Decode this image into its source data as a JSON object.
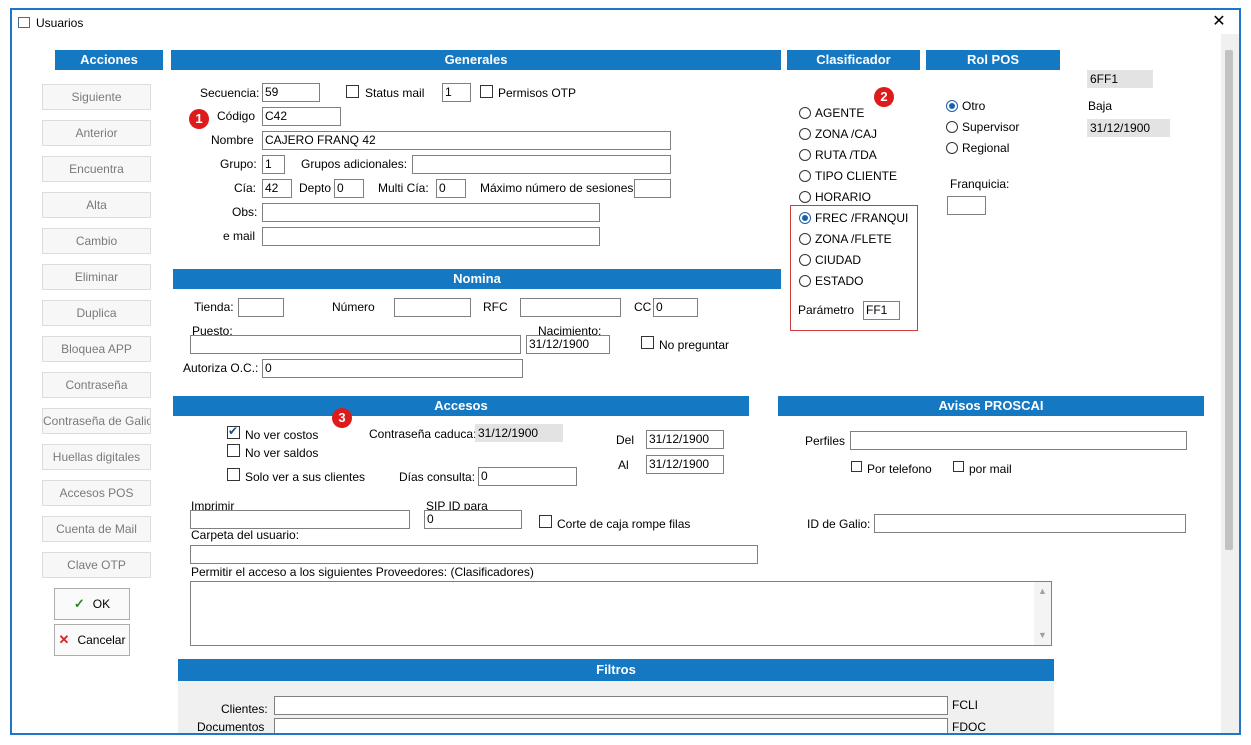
{
  "window": {
    "title": "Usuarios",
    "close": "✕"
  },
  "acciones": {
    "header": "Acciones",
    "items": [
      {
        "label": "Siguiente"
      },
      {
        "label": "Anterior"
      },
      {
        "label": "Encuentra"
      },
      {
        "label": "Alta"
      },
      {
        "label": "Cambio"
      },
      {
        "label": "Eliminar"
      },
      {
        "label": "Duplica"
      },
      {
        "label": "Bloquea APP"
      },
      {
        "label": "Contraseña"
      },
      {
        "label": "Contraseña de Galio"
      },
      {
        "label": "Huellas digitales"
      },
      {
        "label": "Accesos POS"
      },
      {
        "label": "Cuenta de Mail"
      },
      {
        "label": "Clave OTP"
      }
    ],
    "ok": "OK",
    "cancel": "Cancelar"
  },
  "generales": {
    "header": "Generales",
    "secuencia_label": "Secuencia:",
    "secuencia": "59",
    "status_mail_label": "Status mail",
    "status_mail_value": "1",
    "permisos_otp_label": "Permisos OTP",
    "codigo_label": "Código",
    "codigo": "C42",
    "nombre_label": "Nombre",
    "nombre": "CAJERO FRANQ 42",
    "grupo_label": "Grupo:",
    "grupo": "1",
    "grupos_adicionales_label": "Grupos adicionales:",
    "grupos_adicionales": "",
    "cia_label": "Cía:",
    "cia": "42",
    "depto_label": "Depto",
    "depto": "0",
    "multi_cia_label": "Multi Cía:",
    "multi_cia": "0",
    "max_sesiones_label": "Máximo número de sesiones:",
    "max_sesiones": "",
    "obs_label": "Obs:",
    "obs": "",
    "email_label": "e mail",
    "email": ""
  },
  "badges": {
    "one": "1",
    "two": "2",
    "three": "3"
  },
  "clasificador": {
    "header": "Clasificador",
    "options": [
      {
        "label": "AGENTE",
        "selected": false
      },
      {
        "label": "ZONA /CAJ",
        "selected": false
      },
      {
        "label": "RUTA /TDA",
        "selected": false
      },
      {
        "label": "TIPO CLIENTE",
        "selected": false
      },
      {
        "label": "HORARIO",
        "selected": false
      },
      {
        "label": "FREC /FRANQUI",
        "selected": true
      },
      {
        "label": "ZONA /FLETE",
        "selected": false
      },
      {
        "label": "CIUDAD",
        "selected": false
      },
      {
        "label": "ESTADO",
        "selected": false
      }
    ],
    "parametro_label": "Parámetro",
    "parametro": "FF1"
  },
  "rol_pos": {
    "header": "Rol POS",
    "options": [
      {
        "label": "Otro",
        "selected": true
      },
      {
        "label": "Supervisor",
        "selected": false
      },
      {
        "label": "Regional",
        "selected": false
      }
    ],
    "franquicia_label": "Franquicia:",
    "franquicia": ""
  },
  "info": {
    "code": "6FF1",
    "baja_label": "Baja",
    "baja_date": "31/12/1900"
  },
  "nomina": {
    "header": "Nomina",
    "tienda_label": "Tienda:",
    "tienda": "",
    "numero_label": "Número",
    "numero": "",
    "rfc_label": "RFC",
    "rfc": "",
    "cc_label": "CC",
    "cc": "0",
    "puesto_label": "Puesto:",
    "puesto": "",
    "nacimiento_label": "Nacimiento:",
    "nacimiento": "31/12/1900",
    "no_preguntar_label": "No preguntar",
    "autoriza_label": "Autoriza O.C.:",
    "autoriza": "0"
  },
  "accesos": {
    "header": "Accesos",
    "no_ver_costos": "No ver costos",
    "no_ver_saldos": "No ver saldos",
    "solo_clientes": "Solo ver a sus clientes",
    "contrasena_caduca_label": "Contraseña caduca:",
    "contrasena_caduca": "31/12/1900",
    "del_label": "Del",
    "del": "31/12/1900",
    "al_label": "Al",
    "al": "31/12/1900",
    "dias_consulta_label": "Días consulta:",
    "dias_consulta": "0",
    "imprimir_label": "Imprimir",
    "imprimir": "",
    "sip_label": "SIP ID para",
    "sip": "0",
    "corte_label": "Corte de caja rompe filas",
    "carpeta_label": "Carpeta del usuario:",
    "carpeta": "",
    "permitir_label": "Permitir el acceso a los siguientes Proveedores: (Clasificadores)"
  },
  "avisos": {
    "header": "Avisos PROSCAI",
    "perfiles_label": "Perfiles",
    "perfiles": "",
    "por_telefono": "Por telefono",
    "por_mail": "por mail",
    "id_galio_label": "ID de Galio:",
    "id_galio": ""
  },
  "filtros": {
    "header": "Filtros",
    "clientes_label": "Clientes:",
    "clientes": "",
    "clientes_code": "FCLI",
    "documentos_label": "Documentos",
    "documentos": "",
    "documentos_code": "FDOC"
  }
}
